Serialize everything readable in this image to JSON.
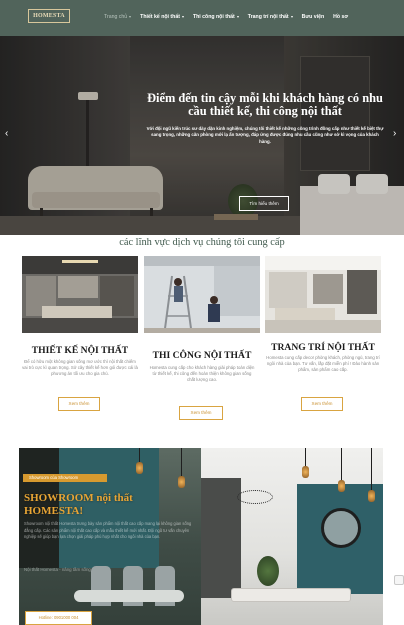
{
  "header": {
    "logo_text": "HOMESTA",
    "nav": [
      {
        "label": "Trang chủ",
        "has_caret": true
      },
      {
        "label": "Thiết kế nội thất",
        "has_caret": true
      },
      {
        "label": "Thi công nội thất",
        "has_caret": true
      },
      {
        "label": "Trang trí nội thất",
        "has_caret": true
      },
      {
        "label": "Bưu viện",
        "has_caret": false
      },
      {
        "label": "Hồ sơ",
        "has_caret": false
      }
    ]
  },
  "hero": {
    "title": "Điểm đến tin cậy mỗi khi khách hàng có nhu cầu thiết kế, thi công nội thất",
    "description": "Với đội ngũ kiến trúc sư dày dặn kinh nghiệm, chúng tôi thiết kế những công trình đồng cấp như thiết kế biệt thự sang trọng, những căn phòng mới lạ ấn tượng, đáp ứng được đúng nhu cầu cũng như sở kì vọng của khách hàng.",
    "button": "Tìm hiểu thêm",
    "prev_icon": "chevron-left-icon",
    "next_icon": "chevron-right-icon"
  },
  "services": {
    "title": "các lĩnh vực dịch vụ chúng tôi cung cấp",
    "cards": [
      {
        "title": "THIẾT KẾ NỘI THẤT",
        "description": "Để có hữu một không gian sống mơ ước thì nội thất chiếm vai trò cực kì quan trọng. Sở cây thiết kế hơn gói được cái là phương án tối ưu cho gia chủ.",
        "button": "Xem thêm"
      },
      {
        "title": "THI CÔNG NỘI THẤT",
        "description": "Homesta cung cấp cho khách hàng giải pháp toàn diện từ thiết kế, thi công đến hoàn thiện không gian sống chất lượng cao.",
        "button": "Xem thêm"
      },
      {
        "title": "TRANG TRÍ NỘI THẤT",
        "description": "Homesta cung cấp decor phòng khách, phòng ngủ, trang trí ngôi nhà của bạn. Tư vấn, lắp đặt miễn phí ! Đảo hành sản phẩm, sản phẩm cao cấp.",
        "button": "Xem thêm"
      }
    ]
  },
  "showroom": {
    "badge": "Showroom của Showroom",
    "title": "SHOWROOM nội thất HOMESTA!",
    "description": "Showroom nội thất Homesta trưng bày sản phẩm nội thất cao cấp mang lại không gian sống đẳng cấp. Các sản phẩm nội thất cao cấp và mẫu thiết kế mới nhất. Đội ngũ tư vấn chuyên nghiệp sẽ giúp bạn lựa chọn giải pháp phù hợp nhất cho ngôi nhà của bạn.",
    "subtitle": "Nội thất Homesta - nâng tầm sống",
    "hotline": "Hotline: 0901000 004"
  }
}
